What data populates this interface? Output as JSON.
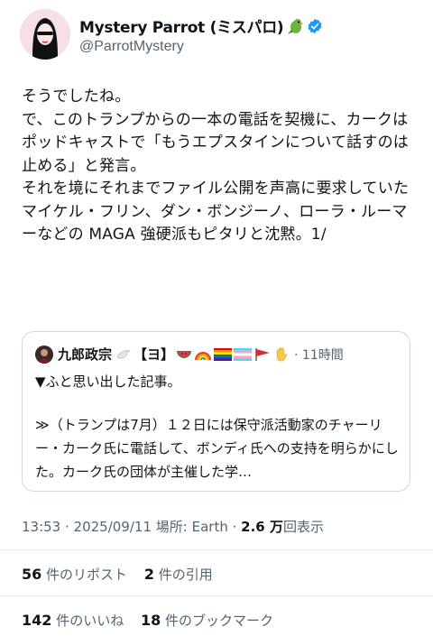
{
  "author": {
    "name": "Mystery Parrot (ミスパロ)",
    "handle": "@ParrotMystery"
  },
  "tweet": {
    "lines": [
      "そうでしたね。",
      "で、このトランプからの一本の電話を契機に、カークはポッドキャストで「もうエプスタインについて話すのは止める」と発言。",
      "それを境にそれまでファイル公開を声高に要求していたマイケル・フリン、ダン・ボンジーノ、ローラ・ルーマーなどの MAGA 強硬派もピタリと沈黙。1/"
    ]
  },
  "quoted": {
    "name": "九郎政宗",
    "tag": "【ヨ】",
    "time": "· 11時間",
    "line1": "▼ふと思い出した記事。",
    "text": "≫（トランプは7月）１２日には保守派活動家のチャーリー・カーク氏に電話して、ボンディ氏への支持を明らかにした。カーク氏の団体が主催した学…"
  },
  "meta": {
    "datetime": "13:53 · 2025/09/11",
    "location": "場所: Earth ·",
    "views_count": "2.6 万",
    "views_label": "回表示"
  },
  "stats": {
    "reposts_count": "56",
    "reposts_label": "件のリポスト",
    "quotes_count": "2",
    "quotes_label": "件の引用",
    "likes_count": "142",
    "likes_label": "件のいいね",
    "bookmarks_count": "18",
    "bookmarks_label": "件のブックマーク"
  },
  "colors": {
    "verified": "#1d9bf0",
    "secondary_text": "#536471",
    "border": "#cfd9de"
  }
}
